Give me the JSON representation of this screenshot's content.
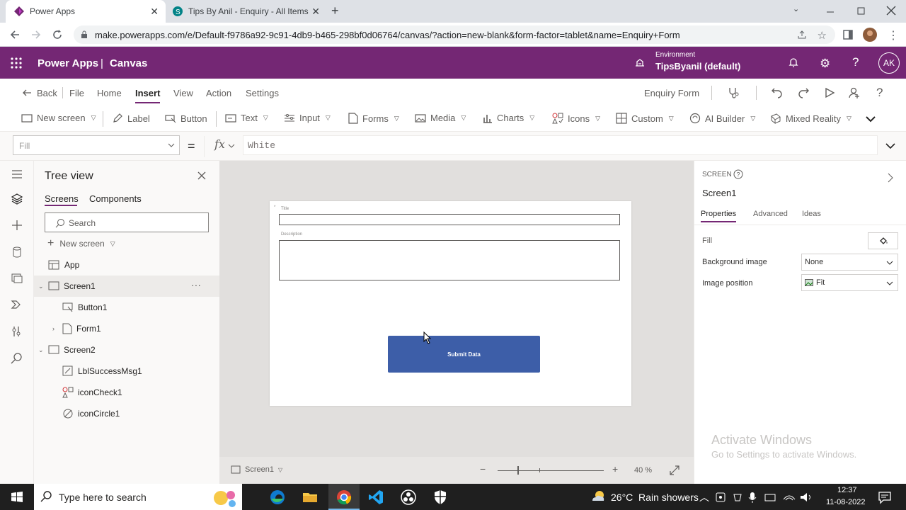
{
  "browser": {
    "tabs": [
      {
        "title": "Power Apps",
        "active": true
      },
      {
        "title": "Tips By Anil - Enquiry - All Items",
        "active": false
      }
    ],
    "url": "make.powerapps.com/e/Default-f9786a92-9c91-4db9-b465-298bf0d06764/canvas/?action=new-blank&form-factor=tablet&name=Enquiry+Form"
  },
  "header": {
    "app_name": "Power Apps",
    "separator": "|",
    "section": "Canvas",
    "environment_label": "Environment",
    "environment_name": "TipsByanil (default)",
    "user_initials": "AK",
    "brand_color": "#742774"
  },
  "menu": {
    "back": "Back",
    "items": [
      "File",
      "Home",
      "Insert",
      "View",
      "Action",
      "Settings"
    ],
    "active": "Insert",
    "app_title": "Enquiry Form"
  },
  "insert_toolbar": {
    "items": [
      "New screen",
      "Label",
      "Button",
      "Text",
      "Input",
      "Forms",
      "Media",
      "Charts",
      "Icons",
      "Custom",
      "AI Builder",
      "Mixed Reality"
    ]
  },
  "formula": {
    "property": "Fill",
    "equals": "=",
    "fx": "fx",
    "value": "White"
  },
  "tree": {
    "title": "Tree view",
    "tabs": [
      "Screens",
      "Components"
    ],
    "search_placeholder": "Search",
    "new_screen": "New screen",
    "nodes": {
      "app": "App",
      "screen1": "Screen1",
      "button1": "Button1",
      "form1": "Form1",
      "screen2": "Screen2",
      "lbl": "LblSuccessMsg1",
      "check": "iconCheck1",
      "circle": "iconCircle1"
    },
    "more": "···"
  },
  "canvas": {
    "field_title_label": "Title",
    "field_desc_label": "Description",
    "submit_label": "Submit Data",
    "submit_color": "#3d5ea8",
    "screen_selector": "Screen1",
    "zoom": "40 %"
  },
  "properties": {
    "kind": "SCREEN",
    "name": "Screen1",
    "tabs": [
      "Properties",
      "Advanced",
      "Ideas"
    ],
    "fill_label": "Fill",
    "bg_image_label": "Background image",
    "bg_image_value": "None",
    "image_position_label": "Image position",
    "image_position_value": "Fit"
  },
  "watermark": {
    "line1": "Activate Windows",
    "line2": "Go to Settings to activate Windows."
  },
  "taskbar": {
    "search_placeholder": "Type here to search",
    "weather": "26°C  Rain showers",
    "time": "12:37",
    "date": "11-08-2022"
  }
}
